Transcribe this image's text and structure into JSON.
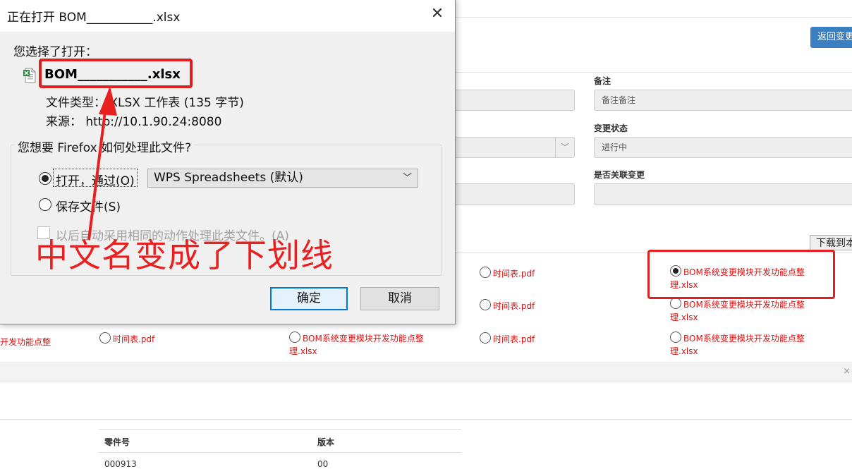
{
  "page": {
    "back_button": "返回变更",
    "download_button": "下载到本",
    "fields": {
      "remark_label": "备注",
      "remark_value": "备注备注",
      "status_label": "变更状态",
      "status_value": "进行中",
      "related_label": "是否关联变更",
      "related_value": ""
    },
    "files": {
      "r1c3": "时间表.pdf",
      "r1c4_line1": "BOM系统变更模块开发功能点整",
      "r1c4_line2": "理.xlsx",
      "r2c3": "时间表.pdf",
      "r2c4_line1": "BOM系统变更模块开发功能点整",
      "r2c4_line2": "理.xlsx",
      "r3c1": "开发功能点整",
      "r3c2": "时间表.pdf",
      "r3c3_line1": "BOM系统变更模块开发功能点整",
      "r3c3_line2": "理.xlsx",
      "r3c4": "时间表.pdf",
      "r3c5_line1": "BOM系统变更模块开发功能点整",
      "r3c5_line2": "理.xlsx"
    },
    "close_glyph": "×",
    "table": {
      "headers": [
        "零件号",
        "版本"
      ],
      "rows": [
        [
          "000913",
          "00"
        ]
      ]
    }
  },
  "dialog": {
    "title": "正在打开 BOM___________.xlsx",
    "close_glyph": "✕",
    "chosen_label": "您选择了打开：",
    "filename": "BOM___________.xlsx",
    "file_type": "文件类型： XLSX 工作表 (135 字节)",
    "source": "来源：    http://10.1.90.24:8080",
    "question": "您想要 Firefox 如何处理此文件?",
    "open_with_label": "打开，通过(O)",
    "open_with_app": "WPS Spreadsheets (默认)",
    "save_label": "保存文件(S)",
    "remember_label": "以后自动采用相同的动作处理此类文件。(A)",
    "ok_button": "确定",
    "cancel_button": "取消"
  },
  "annotation": {
    "text": "中文名变成了下划线",
    "color": "#e82020"
  }
}
